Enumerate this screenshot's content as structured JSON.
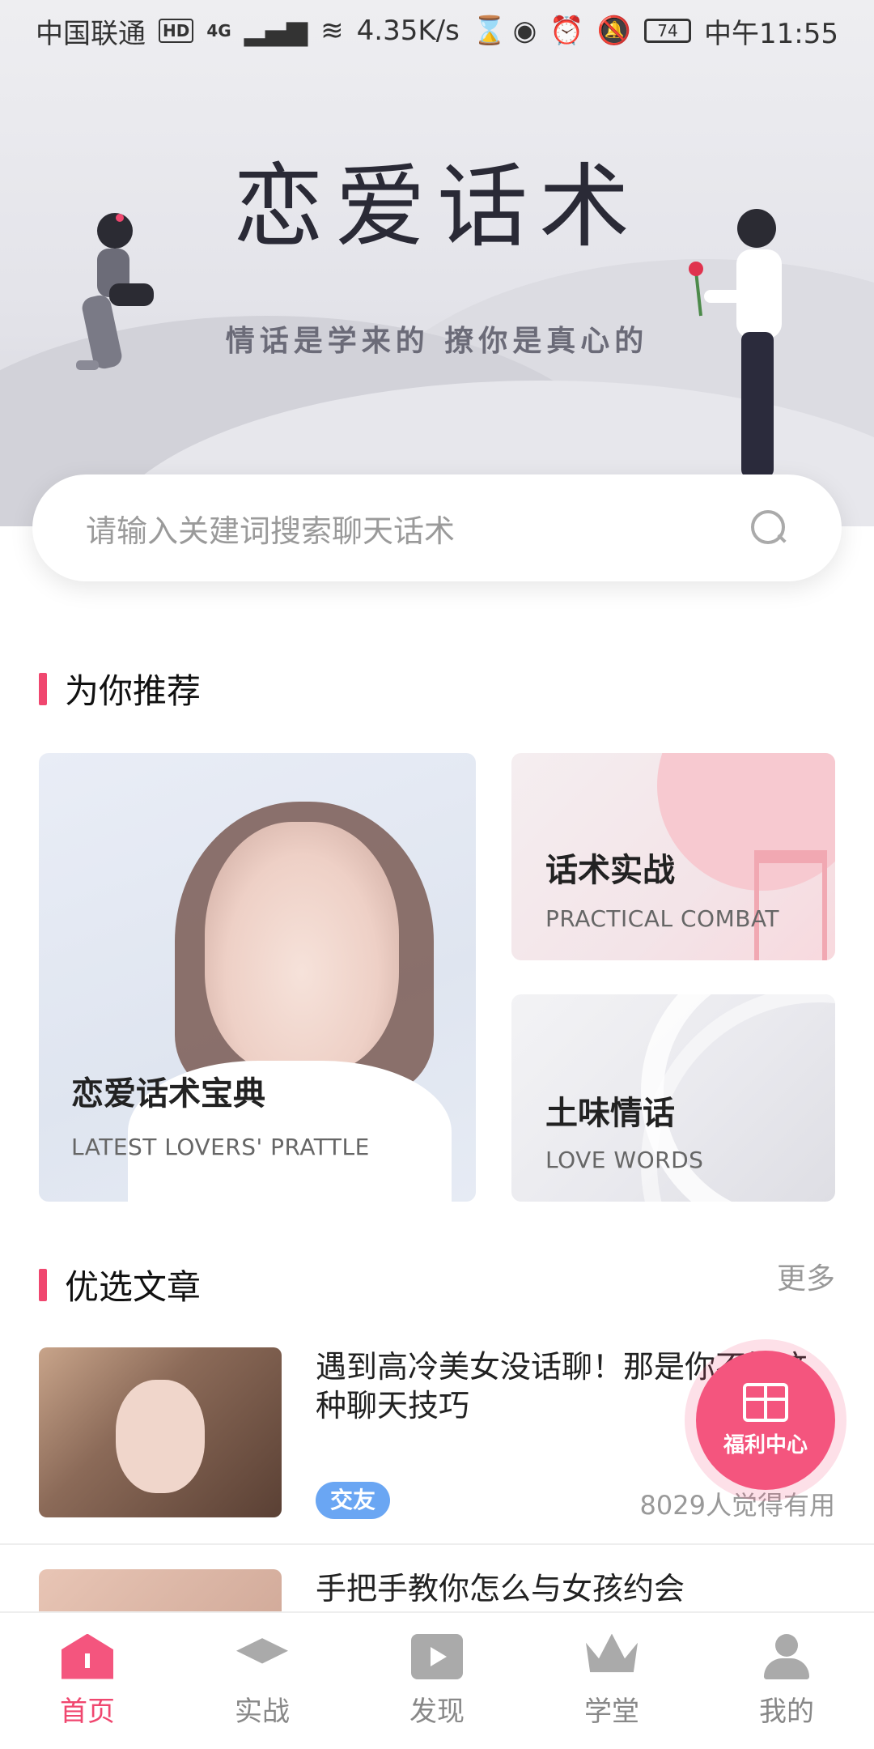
{
  "status_bar": {
    "carrier": "中国联通",
    "hd_badge": "HD",
    "network": "4G",
    "speed": "4.35K/s",
    "battery": "74",
    "time": "中午11:55"
  },
  "hero": {
    "title": "恋爱话术",
    "subtitle": "情话是学来的 撩你是真心的"
  },
  "search": {
    "placeholder": "请输入关建词搜索聊天话术"
  },
  "recommend": {
    "section_title": "为你推荐",
    "cards": [
      {
        "title": "恋爱话术宝典",
        "subtitle": "LATEST LOVERS' PRATTLE"
      },
      {
        "title": "话术实战",
        "subtitle": "PRACTICAL COMBAT"
      },
      {
        "title": "土味情话",
        "subtitle": "LOVE WORDS"
      }
    ]
  },
  "articles": {
    "section_title": "优选文章",
    "more_label": "更多",
    "items": [
      {
        "title": "遇到高冷美女没话聊！那是你不懂这种聊天技巧",
        "tag": "交友",
        "useful": "8029人觉得有用"
      },
      {
        "title": "手把手教你怎么与女孩约会"
      }
    ]
  },
  "gift": {
    "label": "福利中心"
  },
  "bottom_nav": {
    "items": [
      {
        "label": "首页",
        "icon": "home-icon",
        "active": true
      },
      {
        "label": "实战",
        "icon": "graduation-cap-icon",
        "active": false
      },
      {
        "label": "发现",
        "icon": "play-icon",
        "active": false
      },
      {
        "label": "学堂",
        "icon": "crown-icon",
        "active": false
      },
      {
        "label": "我的",
        "icon": "user-icon",
        "active": false
      }
    ]
  },
  "colors": {
    "accent": "#f0476f",
    "tag": "#6aa6f3",
    "gift": "#f4557e"
  }
}
